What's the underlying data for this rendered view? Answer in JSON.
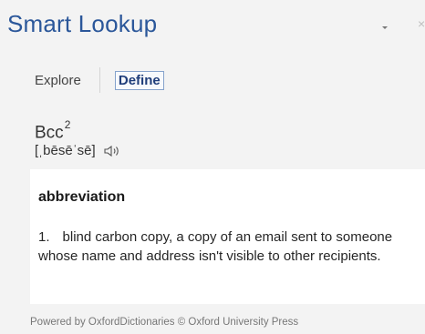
{
  "header": {
    "title": "Smart Lookup",
    "close": "×"
  },
  "tabs": [
    {
      "label": "Explore"
    },
    {
      "label": "Define"
    }
  ],
  "entry": {
    "word": "Bcc",
    "superscript": "2",
    "pronunciation": "[ˌbēsēˈsē]",
    "part_of_speech": "abbreviation",
    "definition_number": "1.",
    "definition": "blind carbon copy, a copy of an email sent to someone whose name and address isn't visible to other recipients."
  },
  "footer": {
    "text": "Powered by OxfordDictionaries © Oxford University Press"
  }
}
